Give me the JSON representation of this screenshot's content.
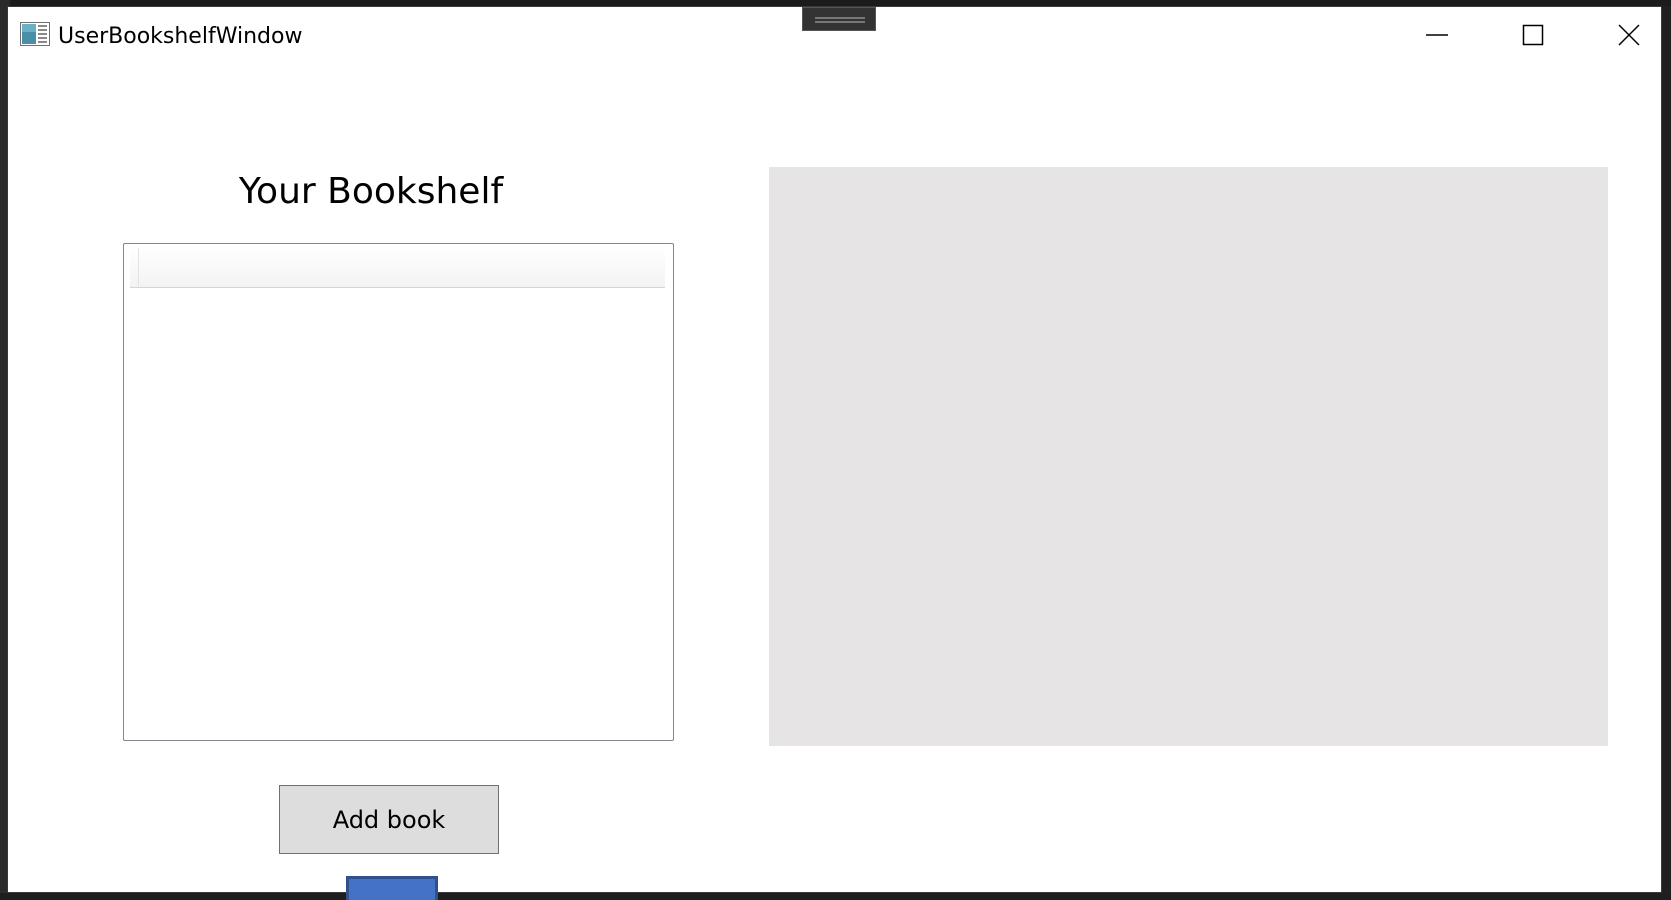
{
  "window": {
    "title": "UserBookshelfWindow"
  },
  "caption_buttons": {
    "minimize": "minimize-icon",
    "maximize": "maximize-icon",
    "close": "close-icon"
  },
  "bookshelf": {
    "heading": "Your Bookshelf",
    "items": []
  },
  "actions": {
    "add_book_label": "Add book"
  },
  "colors": {
    "panel_bg": "#e6e4e5",
    "button_bg": "#dddddd",
    "accent_blue": "#4472c4"
  }
}
